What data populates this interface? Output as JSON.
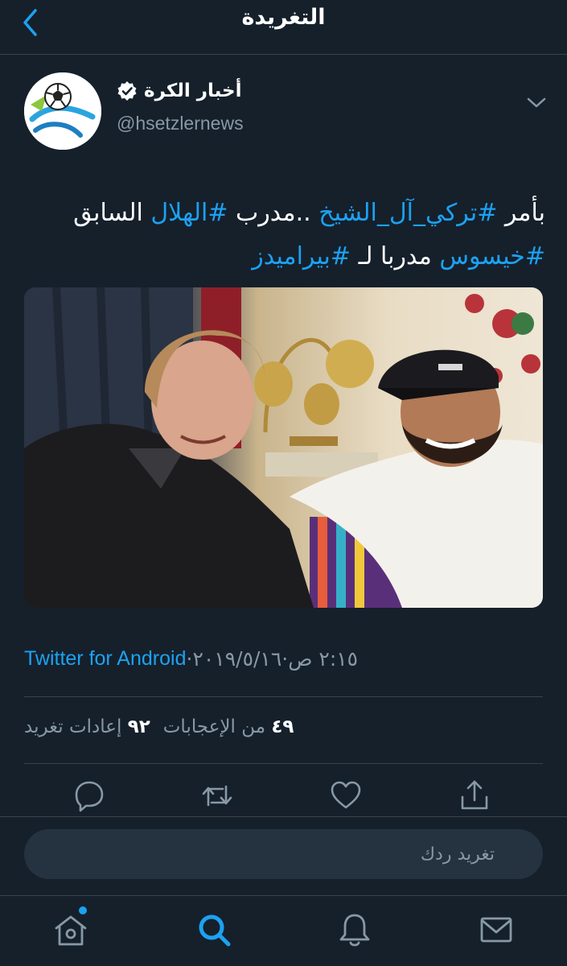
{
  "header": {
    "title": "التغريدة",
    "back_icon": "chevron-left-icon"
  },
  "author": {
    "display_name": "أخبار الكرة",
    "handle": "@hsetzlernews",
    "verified": true,
    "avatar_text": "كورة"
  },
  "tweet": {
    "line1": [
      {
        "text": "بأمر ",
        "hashtag": false
      },
      {
        "text": "#تركي_آل_الشيخ",
        "hashtag": true
      },
      {
        "text": " ..مدرب ",
        "hashtag": false
      },
      {
        "text": "#الهلال",
        "hashtag": true
      },
      {
        "text": " السابق",
        "hashtag": false
      }
    ],
    "line2": [
      {
        "text": "#خيسوس",
        "hashtag": true
      },
      {
        "text": " مدربا لـ ",
        "hashtag": false
      },
      {
        "text": "#بيراميدز",
        "hashtag": true
      }
    ]
  },
  "meta": {
    "source": "Twitter for Android",
    "dot1": " · ",
    "date": "٢٠١٩/٥/١٦",
    "dot2": " · ",
    "time": "٢:١٥ ص"
  },
  "stats": {
    "likes_count": "٤٩",
    "likes_label": "من الإعجابات",
    "retweets_count": "٩٢",
    "retweets_label": "إعادات تغريد"
  },
  "reply": {
    "placeholder": "تغريد ردك"
  },
  "colors": {
    "background": "#15202b",
    "accent": "#1da1f2",
    "muted": "#8899a6",
    "border": "#38444d"
  }
}
